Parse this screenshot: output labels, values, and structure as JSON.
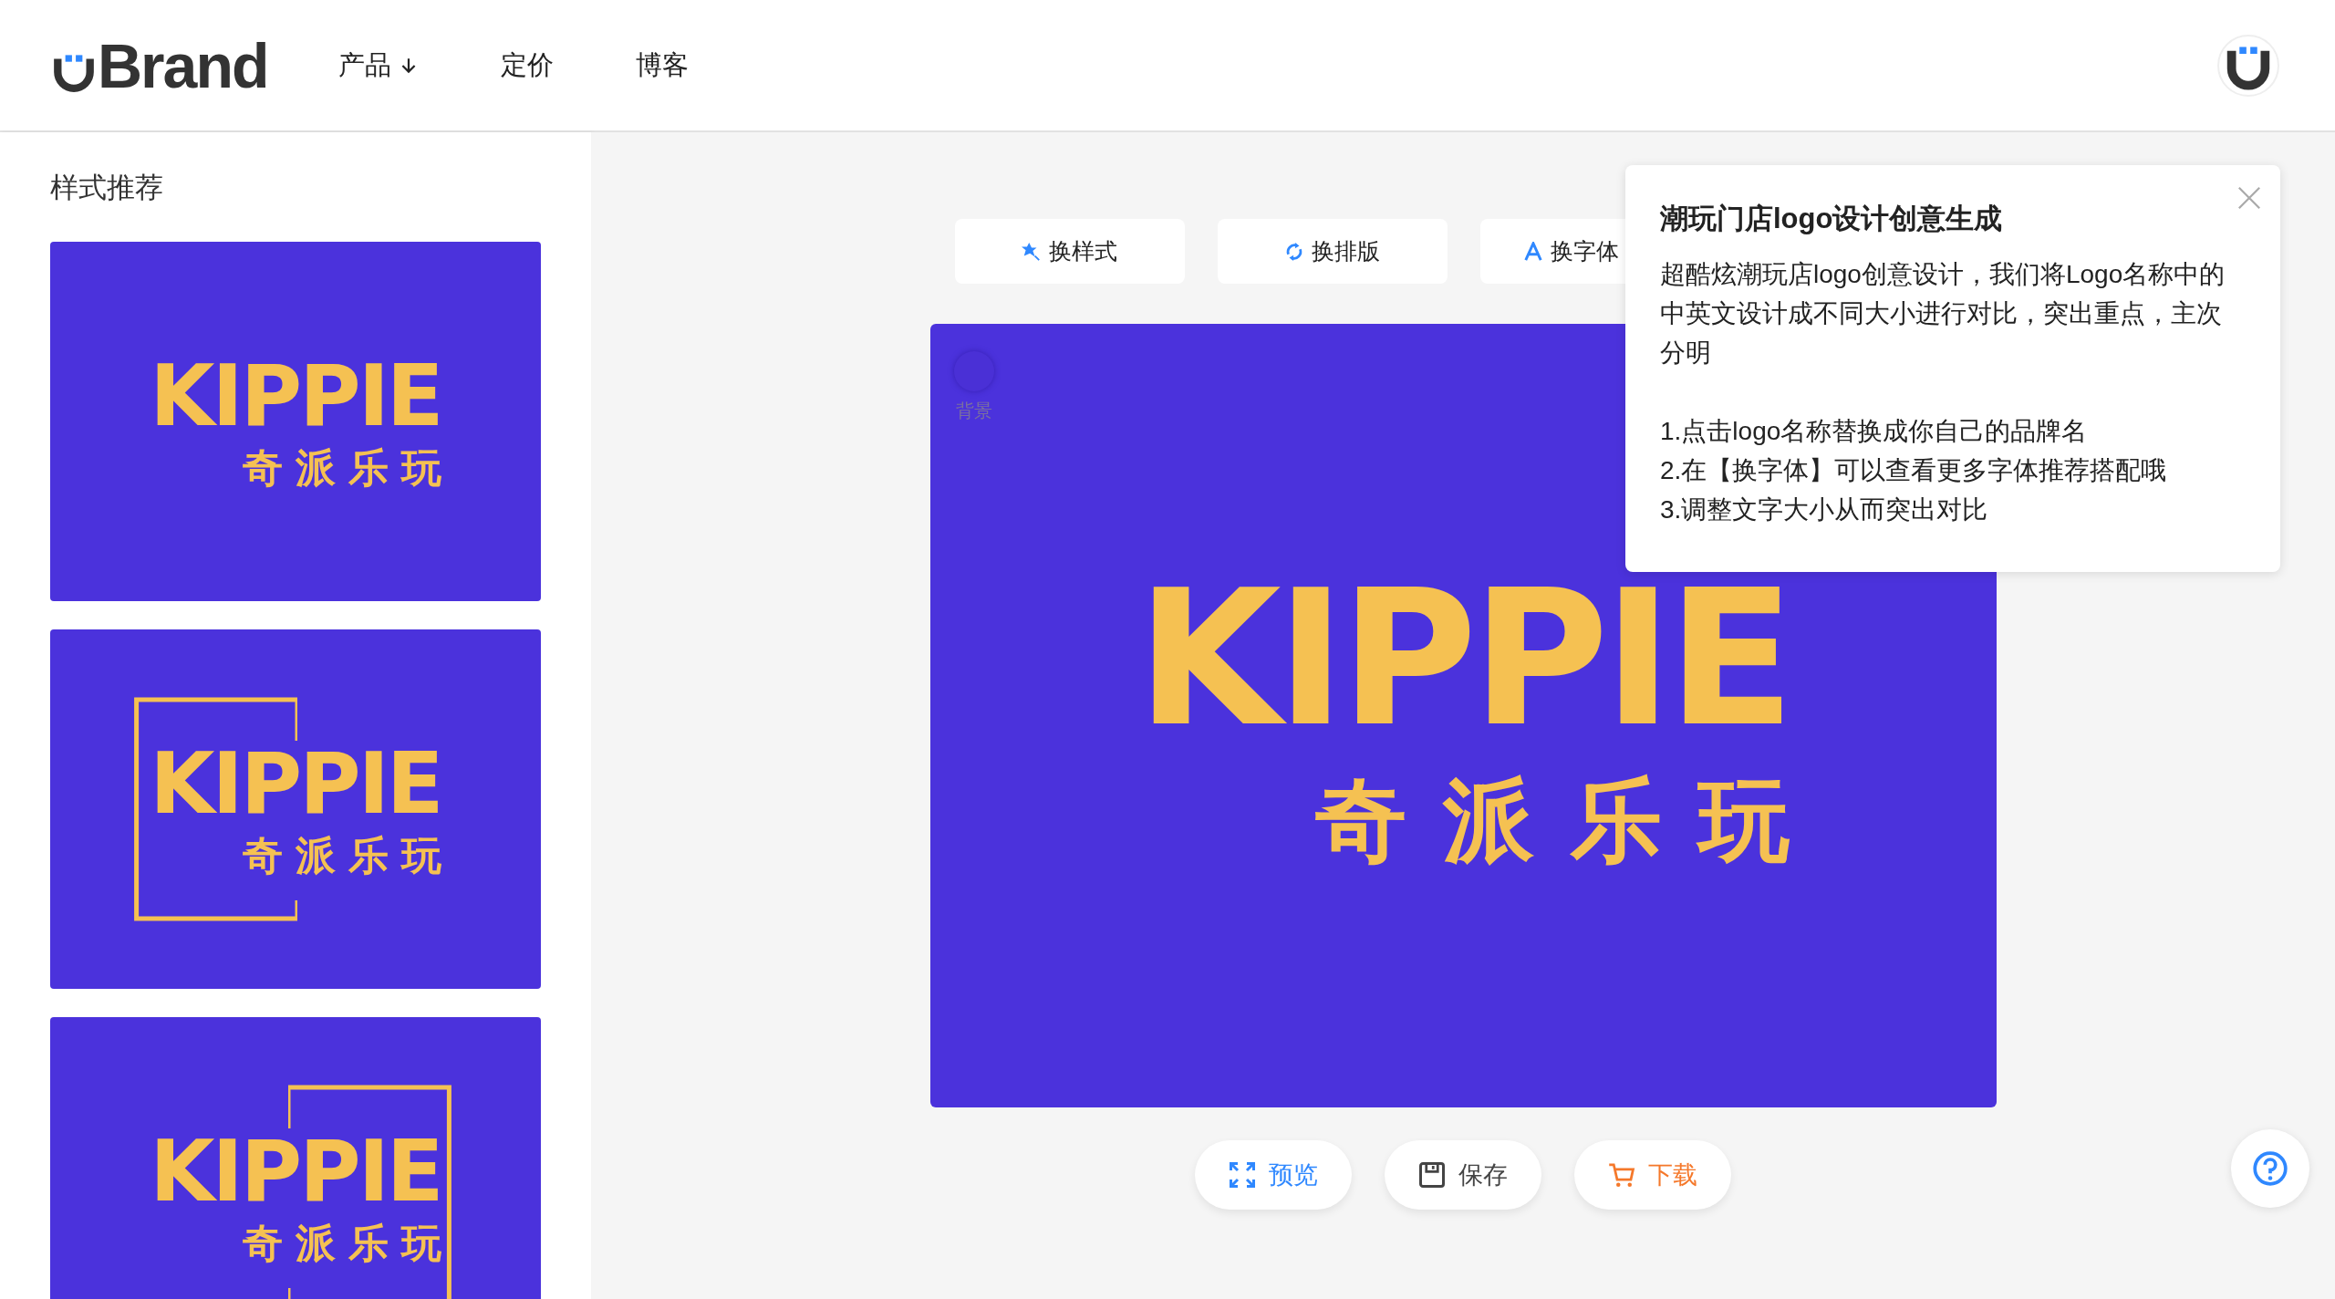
{
  "header": {
    "brand": "Brand",
    "nav": [
      {
        "label": "产品",
        "dropdown": true
      },
      {
        "label": "定价",
        "dropdown": false
      },
      {
        "label": "博客",
        "dropdown": false
      }
    ]
  },
  "sidebar": {
    "title": "样式推荐",
    "styles": [
      {
        "kind": "plain",
        "name": "KIPPIE",
        "subtitle": "奇派乐玩"
      },
      {
        "kind": "frame-left",
        "name": "KIPPIE",
        "subtitle": "奇派乐玩"
      },
      {
        "kind": "frame-right",
        "name": "KIPPIE",
        "subtitle": "奇派乐玩"
      }
    ]
  },
  "toolbar": [
    {
      "kind": "style",
      "label": "换样式"
    },
    {
      "kind": "layout",
      "label": "换排版"
    },
    {
      "kind": "font",
      "label": "换字体"
    }
  ],
  "canvas": {
    "background_label": "背景",
    "name": "KIPPIE",
    "subtitle": "奇派乐玩"
  },
  "actions": [
    {
      "kind": "preview",
      "label": "预览"
    },
    {
      "kind": "save",
      "label": "保存"
    },
    {
      "kind": "download",
      "label": "下载"
    }
  ],
  "tip": {
    "title": "潮玩门店logo设计创意生成",
    "body": "超酷炫潮玩店logo创意设计，我们将Logo名称中的中英文设计成不同大小进行对比，突出重点，主次分明",
    "steps": [
      "1.点击logo名称替换成你自己的品牌名",
      "2.在【换字体】可以查看更多字体推荐搭配哦",
      "3.调整文字大小从而突出对比"
    ]
  }
}
